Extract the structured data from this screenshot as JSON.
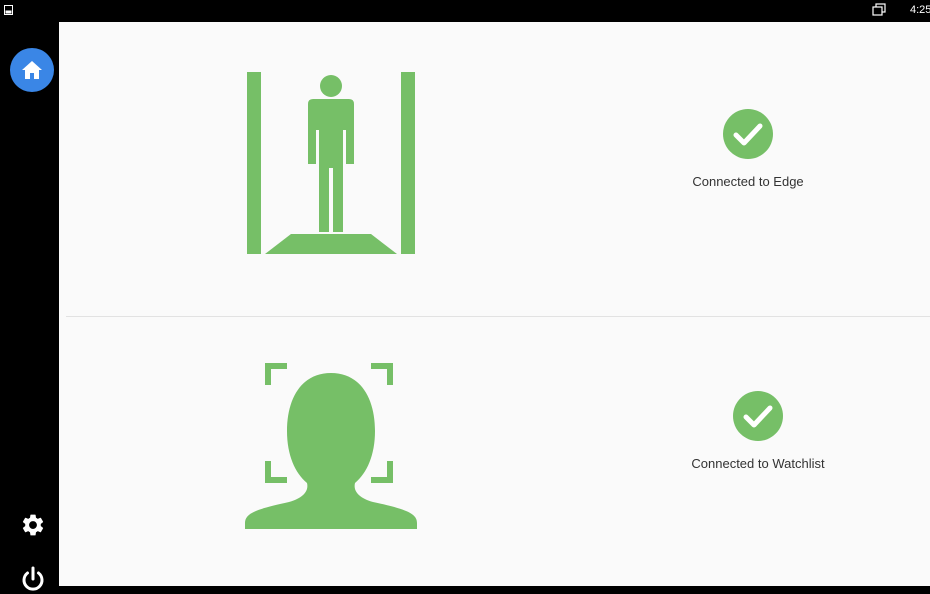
{
  "status_bar": {
    "time": "4:25",
    "left_icon": "notification-icon",
    "right_icon": "window-restore-icon"
  },
  "sidebar": {
    "home_icon": "home-icon",
    "settings_icon": "gear-icon",
    "power_icon": "power-icon",
    "accent_color": "#3a86e6"
  },
  "main": {
    "edge": {
      "icon": "body-scanner-icon",
      "status_icon": "check-circle-icon",
      "label": "Connected to Edge"
    },
    "watchlist": {
      "icon": "face-scan-icon",
      "status_icon": "check-circle-icon",
      "label": "Connected to Watchlist"
    },
    "accent_color": "#76bf67"
  }
}
